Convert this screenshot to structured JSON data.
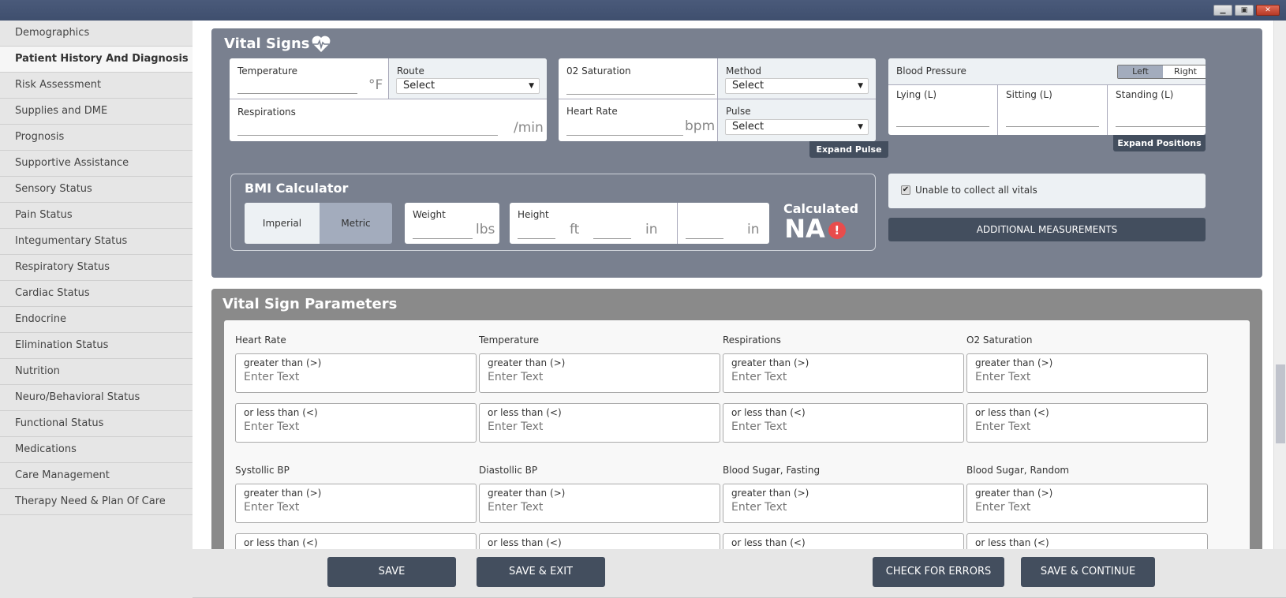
{
  "window": {
    "controls": [
      "minimize",
      "restore",
      "close"
    ]
  },
  "sidebar": {
    "items": [
      {
        "label": "Demographics",
        "active": false
      },
      {
        "label": "Patient History And Diagnosis",
        "active": true
      },
      {
        "label": "Risk Assessment",
        "active": false
      },
      {
        "label": "Supplies and DME",
        "active": false
      },
      {
        "label": "Prognosis",
        "active": false
      },
      {
        "label": "Supportive Assistance",
        "active": false
      },
      {
        "label": "Sensory Status",
        "active": false
      },
      {
        "label": "Pain Status",
        "active": false
      },
      {
        "label": "Integumentary Status",
        "active": false
      },
      {
        "label": "Respiratory Status",
        "active": false
      },
      {
        "label": "Cardiac Status",
        "active": false
      },
      {
        "label": "Endocrine",
        "active": false
      },
      {
        "label": "Elimination Status",
        "active": false
      },
      {
        "label": "Nutrition",
        "active": false
      },
      {
        "label": "Neuro/Behavioral Status",
        "active": false
      },
      {
        "label": "Functional Status",
        "active": false
      },
      {
        "label": "Medications",
        "active": false
      },
      {
        "label": "Care Management",
        "active": false
      },
      {
        "label": "Therapy Need & Plan Of Care",
        "active": false
      }
    ]
  },
  "vital_signs": {
    "title": "Vital Signs",
    "temperature": {
      "label": "Temperature",
      "unit": "°F",
      "value": ""
    },
    "route": {
      "label": "Route",
      "selected": "Select"
    },
    "respirations": {
      "label": "Respirations",
      "unit": "/min",
      "value": ""
    },
    "o2_saturation": {
      "label": "02 Saturation",
      "value": ""
    },
    "method": {
      "label": "Method",
      "selected": "Select"
    },
    "heart_rate": {
      "label": "Heart Rate",
      "unit": "bpm",
      "value": ""
    },
    "pulse": {
      "label": "Pulse",
      "selected": "Select"
    },
    "expand_pulse": "Expand Pulse",
    "blood_pressure": {
      "label": "Blood Pressure",
      "sides": [
        "Left",
        "Right"
      ],
      "selected_side": "Left",
      "positions": [
        "Lying (L)",
        "Sitting (L)",
        "Standing (L)"
      ]
    },
    "expand_positions": "Expand Positions",
    "bmi": {
      "title": "BMI Calculator",
      "systems": [
        "Imperial",
        "Metric"
      ],
      "selected_system": "Imperial",
      "weight": {
        "label": "Weight",
        "unit": "lbs"
      },
      "height": {
        "label": "Height",
        "unit_ft": "ft",
        "unit_in": "in",
        "unit_in2": "in"
      },
      "calculated_label": "Calculated",
      "calculated_value": "NA",
      "alert": "!"
    },
    "unable_to_collect": {
      "label": "Unable to collect all vitals",
      "checked": true
    },
    "additional_measurements": "ADDITIONAL MEASUREMENTS"
  },
  "parameters": {
    "title": "Vital Sign Parameters",
    "greater_label": "greater than (>)",
    "less_label": "or less than (<)",
    "placeholder": "Enter Text",
    "rows": [
      [
        "Heart Rate",
        "Temperature",
        "Respirations",
        "O2 Saturation"
      ],
      [
        "Systollic BP",
        "Diastollic BP",
        "Blood Sugar, Fasting",
        "Blood Sugar, Random"
      ]
    ]
  },
  "footer": {
    "save": "SAVE",
    "save_exit": "SAVE & EXIT",
    "check_errors": "CHECK FOR ERRORS",
    "save_continue": "SAVE & CONTINUE"
  },
  "colors": {
    "panel": "#79808f",
    "params_panel": "#8a8a8a",
    "button": "#434e5e",
    "alert": "#e84c4c"
  }
}
